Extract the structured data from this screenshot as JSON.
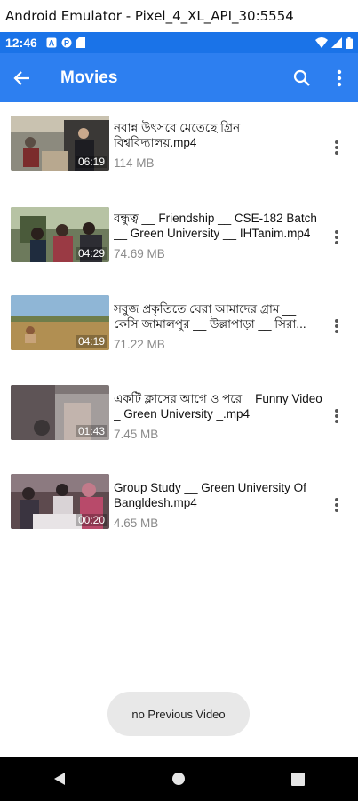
{
  "window": {
    "title": "Android Emulator - Pixel_4_XL_API_30:5554"
  },
  "status_bar": {
    "time": "12:46"
  },
  "app_bar": {
    "title": "Movies",
    "back_icon": "arrow-back-icon",
    "search_icon": "search-icon",
    "menu_icon": "more-vert-icon"
  },
  "colors": {
    "status_bar": "#1a73e8",
    "app_bar": "#2d7ff0",
    "size_text": "#8a8a8a"
  },
  "videos": [
    {
      "title": "নবান্ন উৎসবে মেতেছে গ্রিন বিশ্ববিদ্যালয়.mp4",
      "duration": "06:19",
      "size": "114 MB"
    },
    {
      "title": "বন্ধুত্ব __ Friendship __ CSE-182 Batch __ Green University __ IHTanim.mp4",
      "duration": "04:29",
      "size": "74.69 MB"
    },
    {
      "title": "সবুজ প্রকৃতিতে ঘেরা আমাদের গ্রাম __ কেসি জামালপুর __ উল্লাপাড়া __ সিরা...",
      "duration": "04:19",
      "size": "71.22 MB"
    },
    {
      "title": "একটি ক্লাসের আগে ও পরে _ Funny Video _ Green University _.mp4",
      "duration": "01:43",
      "size": "7.45 MB"
    },
    {
      "title": "Group Study __ Green University Of Bangldesh.mp4",
      "duration": "00:20",
      "size": "4.65 MB"
    }
  ],
  "toast": {
    "text": "no Previous Video"
  }
}
